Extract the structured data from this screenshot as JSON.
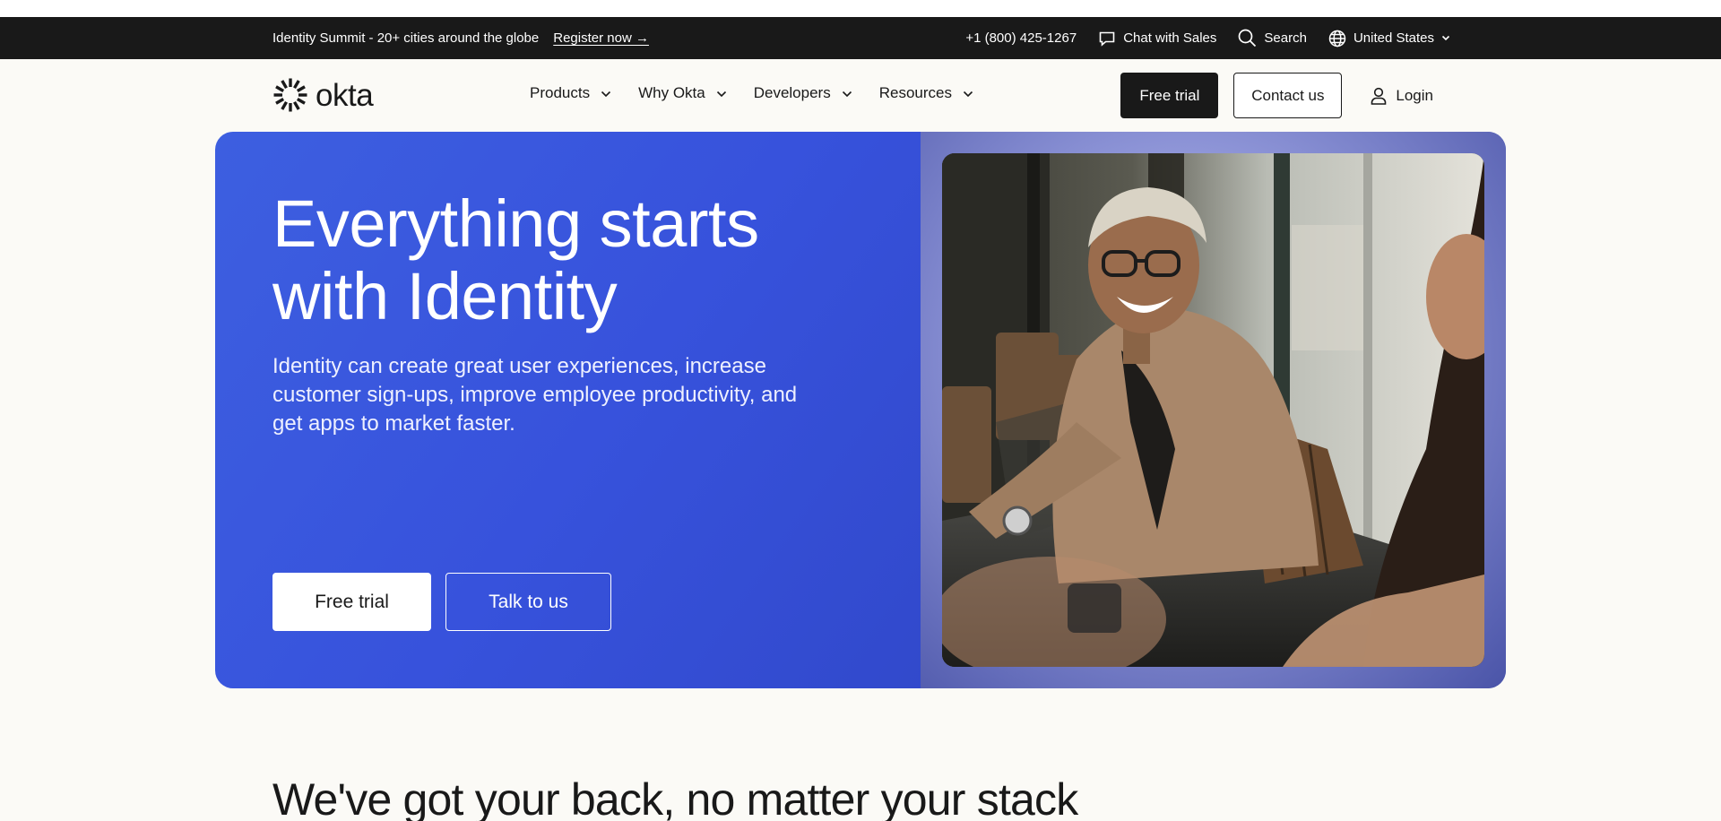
{
  "promo": {
    "text": "Identity Summit - 20+ cities around the globe",
    "link": "Register now →"
  },
  "utility": {
    "phone": "+1 (800) 425-1267",
    "chat": "Chat with Sales",
    "search": "Search",
    "region": "United States"
  },
  "nav": {
    "logo": "okta",
    "items": [
      {
        "label": "Products"
      },
      {
        "label": "Why Okta"
      },
      {
        "label": "Developers"
      },
      {
        "label": "Resources"
      }
    ],
    "free_trial": "Free trial",
    "contact": "Contact us",
    "login": "Login"
  },
  "hero": {
    "title": "Everything starts with Identity",
    "subtitle": "Identity can create great user experiences, increase customer sign-ups, improve employee productivity, and get apps to market faster.",
    "primary_button": "Free trial",
    "secondary_button": "Talk to us",
    "image_alt": "Smiling woman in a meeting room"
  },
  "section": {
    "title": "We've got your back, no matter your stack"
  },
  "colors": {
    "hero_blue": "#3752dc",
    "dark": "#191919",
    "page_bg": "#fbfaf6"
  }
}
